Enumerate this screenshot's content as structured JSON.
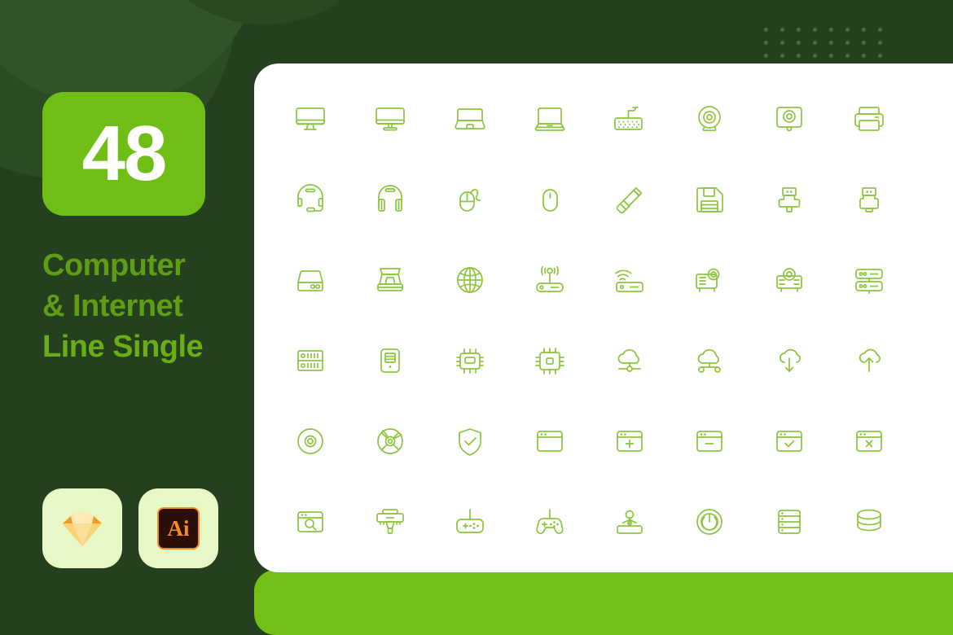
{
  "theme": {
    "bg_dark_green": "#25401f",
    "accent_green": "#72bf17",
    "badge_green": "#6fbe16",
    "title_green": "#5f9d17",
    "icon_stroke": "#8cc63f",
    "card_white": "#ffffff",
    "app_badge_bg": "#e8f7c6",
    "ai_orange": "#f58a28",
    "dot_color": "#4e6b45"
  },
  "sidebar": {
    "count": "48",
    "title_lines": [
      "Computer",
      "& Internet",
      "Line Single"
    ],
    "app_badges": [
      {
        "name": "sketch-logo",
        "label": ""
      },
      {
        "name": "adobe-illustrator-logo",
        "label": "Ai"
      }
    ]
  },
  "icon_set": {
    "total": 48,
    "columns": 8,
    "rows": 6,
    "icons": [
      {
        "id": 1,
        "name": "desktop-monitor-icon",
        "label": "Desktop Monitor"
      },
      {
        "id": 2,
        "name": "imac-monitor-icon",
        "label": "iMac Monitor"
      },
      {
        "id": 3,
        "name": "laptop-closed-icon",
        "label": "Laptop Closed"
      },
      {
        "id": 4,
        "name": "laptop-open-icon",
        "label": "Laptop Open"
      },
      {
        "id": 5,
        "name": "keyboard-icon",
        "label": "Keyboard"
      },
      {
        "id": 6,
        "name": "webcam-round-icon",
        "label": "Webcam Round"
      },
      {
        "id": 7,
        "name": "webcam-square-icon",
        "label": "Webcam Square"
      },
      {
        "id": 8,
        "name": "printer-icon",
        "label": "Printer"
      },
      {
        "id": 9,
        "name": "headset-mic-icon",
        "label": "Headset with Mic"
      },
      {
        "id": 10,
        "name": "headphones-icon",
        "label": "Headphones"
      },
      {
        "id": 11,
        "name": "mouse-wired-icon",
        "label": "Wired Mouse"
      },
      {
        "id": 12,
        "name": "mouse-wireless-icon",
        "label": "Wireless Mouse"
      },
      {
        "id": 13,
        "name": "usb-flash-drive-icon",
        "label": "USB Flash Drive"
      },
      {
        "id": 14,
        "name": "floppy-disk-icon",
        "label": "Floppy Disk"
      },
      {
        "id": 15,
        "name": "usb-connector-icon",
        "label": "USB Connector"
      },
      {
        "id": 16,
        "name": "usb-plug-icon",
        "label": "USB Plug"
      },
      {
        "id": 17,
        "name": "external-hard-drive-icon",
        "label": "External Hard Drive"
      },
      {
        "id": 18,
        "name": "flatbed-scanner-icon",
        "label": "Flatbed Scanner"
      },
      {
        "id": 19,
        "name": "globe-internet-icon",
        "label": "Globe Internet"
      },
      {
        "id": 20,
        "name": "wifi-router-icon",
        "label": "WiFi Router"
      },
      {
        "id": 21,
        "name": "wireless-modem-icon",
        "label": "Wireless Modem"
      },
      {
        "id": 22,
        "name": "projector-side-icon",
        "label": "Projector Side"
      },
      {
        "id": 23,
        "name": "projector-front-icon",
        "label": "Projector Front"
      },
      {
        "id": 24,
        "name": "network-switch-icon",
        "label": "Network Switch"
      },
      {
        "id": 25,
        "name": "server-rack-icon",
        "label": "Server Rack"
      },
      {
        "id": 26,
        "name": "computer-tower-icon",
        "label": "Computer Tower"
      },
      {
        "id": 27,
        "name": "cpu-chip-icon",
        "label": "CPU Chip"
      },
      {
        "id": 28,
        "name": "microchip-icon",
        "label": "Microchip"
      },
      {
        "id": 29,
        "name": "cloud-network-icon",
        "label": "Cloud Network"
      },
      {
        "id": 30,
        "name": "cloud-computing-icon",
        "label": "Cloud Computing"
      },
      {
        "id": 31,
        "name": "cloud-download-icon",
        "label": "Cloud Download"
      },
      {
        "id": 32,
        "name": "cloud-upload-icon",
        "label": "Cloud Upload"
      },
      {
        "id": 33,
        "name": "compact-disc-icon",
        "label": "Compact Disc"
      },
      {
        "id": 34,
        "name": "dvd-disc-icon",
        "label": "DVD Disc"
      },
      {
        "id": 35,
        "name": "security-shield-icon",
        "label": "Security Shield"
      },
      {
        "id": 36,
        "name": "browser-window-icon",
        "label": "Browser Window"
      },
      {
        "id": 37,
        "name": "browser-add-icon",
        "label": "Browser Add"
      },
      {
        "id": 38,
        "name": "browser-remove-icon",
        "label": "Browser Remove"
      },
      {
        "id": 39,
        "name": "browser-check-icon",
        "label": "Browser Check"
      },
      {
        "id": 40,
        "name": "browser-close-icon",
        "label": "Browser Close"
      },
      {
        "id": 41,
        "name": "browser-search-icon",
        "label": "Browser Search"
      },
      {
        "id": 42,
        "name": "3d-printer-icon",
        "label": "3D Printer"
      },
      {
        "id": 43,
        "name": "gamepad-flat-icon",
        "label": "Gamepad Flat"
      },
      {
        "id": 44,
        "name": "game-controller-icon",
        "label": "Game Controller"
      },
      {
        "id": 45,
        "name": "joystick-icon",
        "label": "Joystick"
      },
      {
        "id": 46,
        "name": "power-button-icon",
        "label": "Power Button"
      },
      {
        "id": 47,
        "name": "database-rack-icon",
        "label": "Database Rack"
      },
      {
        "id": 48,
        "name": "database-stack-icon",
        "label": "Database Stack"
      }
    ]
  }
}
